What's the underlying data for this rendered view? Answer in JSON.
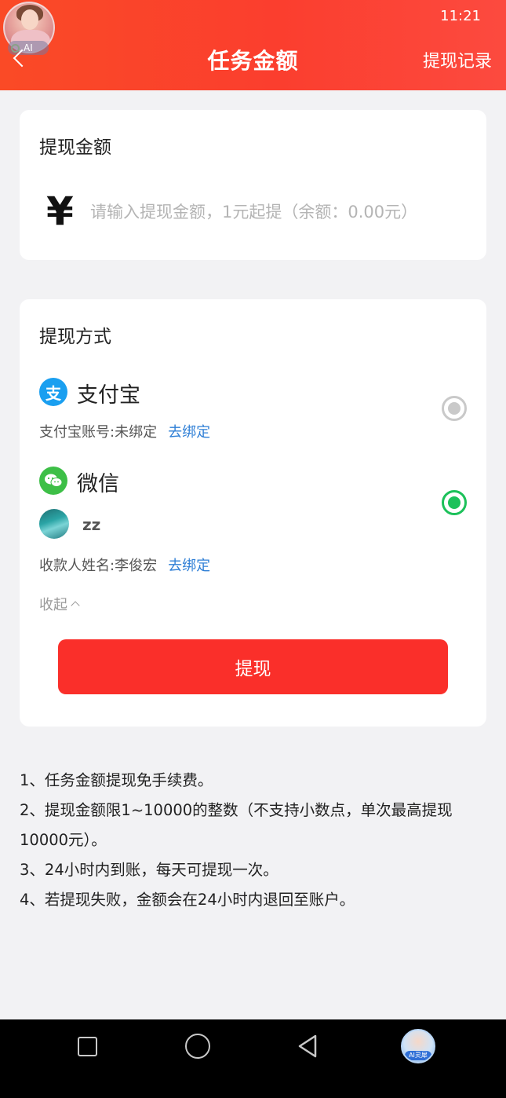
{
  "status": {
    "time": "11:21"
  },
  "header": {
    "title": "任务金额",
    "right_action": "提现记录",
    "float_badge": "AI"
  },
  "amount_card": {
    "title": "提现金额",
    "currency_symbol": "¥",
    "input_value": "",
    "input_placeholder": "请输入提现金额，1元起提（余额：0.00元）"
  },
  "method_card": {
    "title": "提现方式",
    "alipay": {
      "icon_glyph": "支",
      "name": "支付宝",
      "account_label": "支付宝账号:未绑定",
      "bind_link": "去绑定",
      "selected": false
    },
    "wechat": {
      "name": "微信",
      "user_name": "zz",
      "payee_label": "收款人姓名:李俊宏",
      "bind_link": "去绑定",
      "selected": true
    },
    "collapse_label": "收起",
    "submit_label": "提现"
  },
  "notes": [
    "1、任务金额提现免手续费。",
    "2、提现金额限1~10000的整数（不支持小数点，单次最高提现10000元）。",
    "3、24小时内到账，每天可提现一次。",
    "4、若提现失败，金额会在24小时内退回至账户。"
  ],
  "navbar": {
    "assistant_label": "AI灵犀"
  },
  "colors": {
    "header_gradient_start": "#fa4a26",
    "header_gradient_end": "#fc4a3f",
    "submit_button": "#fa2f2a",
    "link": "#2f7fd6",
    "radio_selected": "#1cc15a",
    "alipay_blue": "#1a9ff0",
    "wechat_green": "#3dbf47"
  }
}
